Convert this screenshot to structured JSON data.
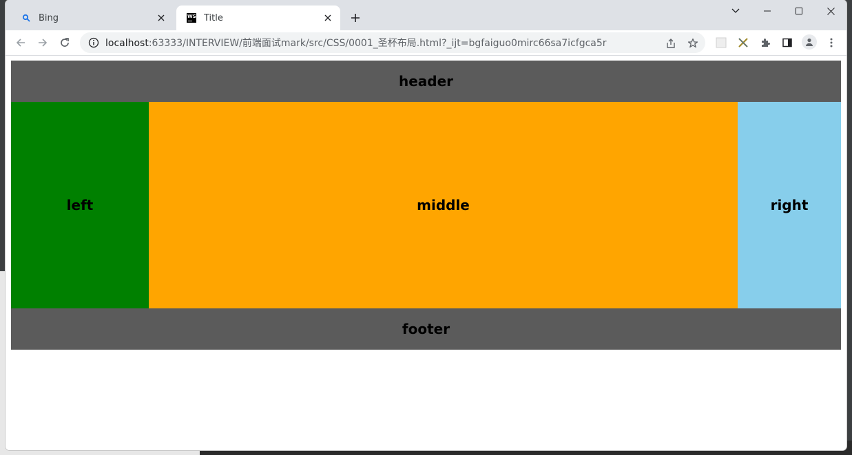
{
  "browser": {
    "tabs": [
      {
        "title": "Bing",
        "favicon": "bing-search-icon",
        "active": false
      },
      {
        "title": "Title",
        "favicon": "webstorm-icon",
        "active": true
      }
    ],
    "url_host": "localhost",
    "url_rest": ":63333/INTERVIEW/前端面试mark/src/CSS/0001_圣杯布局.html?_ijt=bgfaiguo0mirc66sa7icfgca5r"
  },
  "layout": {
    "header": "header",
    "left": "left",
    "middle": "middle",
    "right": "right",
    "footer": "footer"
  },
  "colors": {
    "header_bg": "#5b5b5b",
    "left_bg": "#008000",
    "middle_bg": "#ffa500",
    "right_bg": "#87ceeb",
    "footer_bg": "#5b5b5b"
  }
}
